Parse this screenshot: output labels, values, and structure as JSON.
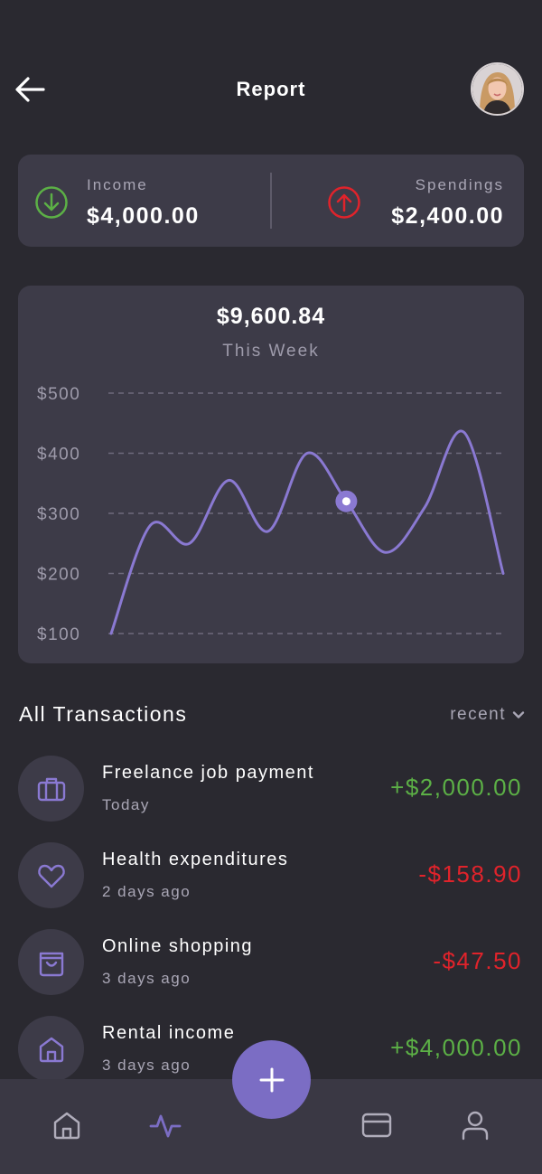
{
  "header": {
    "title": "Report",
    "back_icon": "arrow-left-icon",
    "avatar_icon": "user-avatar"
  },
  "summary": {
    "income_label": "Income",
    "income_value": "$4,000.00",
    "spendings_label": "Spendings",
    "spendings_value": "$2,400.00",
    "income_color": "#5cb046",
    "spendings_color": "#e0232b"
  },
  "chart": {
    "total": "$9,600.84",
    "period": "This Week"
  },
  "chart_data": {
    "type": "line",
    "ylim": [
      100,
      500
    ],
    "yticks": [
      "$100",
      "$200",
      "$300",
      "$400",
      "$500"
    ],
    "ytick_values": [
      100,
      200,
      300,
      400,
      500
    ],
    "grid": true,
    "series": [
      {
        "values": [
          100,
          280,
          250,
          355,
          270,
          400,
          320,
          235,
          310,
          435,
          200
        ]
      }
    ],
    "highlight_index": 6,
    "line_color": "#8a79d2"
  },
  "transactions": {
    "heading": "All Transactions",
    "sort_label": "recent",
    "items": [
      {
        "title": "Freelance job payment",
        "date": "Today",
        "amount": "+$2,000.00",
        "icon": "briefcase-icon"
      },
      {
        "title": "Health expenditures",
        "date": "2 days ago",
        "amount": "-$158.90",
        "icon": "heart-icon"
      },
      {
        "title": "Online shopping",
        "date": "3 days ago",
        "amount": "-$47.50",
        "icon": "shopping-bag-icon"
      },
      {
        "title": "Rental income",
        "date": "3 days ago",
        "amount": "+$4,000.00",
        "icon": "house-icon"
      }
    ]
  },
  "nav": {
    "items": [
      "home-icon",
      "activity-icon",
      "card-icon",
      "profile-icon"
    ],
    "active": "activity-icon",
    "fab_icon": "plus-icon",
    "accent": "#7b6dc4"
  }
}
